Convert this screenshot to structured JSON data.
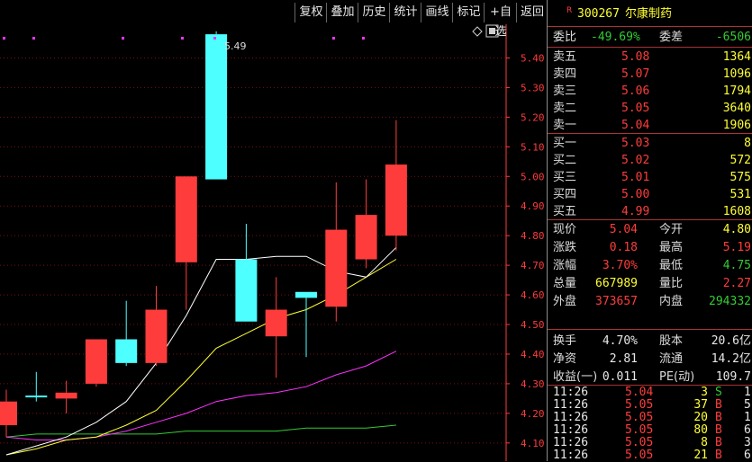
{
  "toolbar": {
    "buttons": [
      "复权",
      "叠加",
      "历史",
      "统计",
      "画线",
      "标记",
      "+自选",
      "返回"
    ]
  },
  "stock_header": {
    "badge": "R",
    "code": "300267",
    "name": "尔康制药"
  },
  "order_ratio": {
    "label": "委比",
    "value": "-49.69%",
    "diff_label": "委差",
    "diff_value": "-6506"
  },
  "asks": [
    {
      "label": "卖五",
      "price": "5.08",
      "volume": "1364"
    },
    {
      "label": "卖四",
      "price": "5.07",
      "volume": "1096"
    },
    {
      "label": "卖三",
      "price": "5.06",
      "volume": "1794"
    },
    {
      "label": "卖二",
      "price": "5.05",
      "volume": "3640"
    },
    {
      "label": "卖一",
      "price": "5.04",
      "volume": "1906"
    }
  ],
  "bids": [
    {
      "label": "买一",
      "price": "5.03",
      "volume": "8"
    },
    {
      "label": "买二",
      "price": "5.02",
      "volume": "572"
    },
    {
      "label": "买三",
      "price": "5.01",
      "volume": "575"
    },
    {
      "label": "买四",
      "price": "5.00",
      "volume": "531"
    },
    {
      "label": "买五",
      "price": "4.99",
      "volume": "1608"
    }
  ],
  "quote": [
    {
      "l1": "现价",
      "v1": "5.04",
      "c1": "red",
      "l2": "今开",
      "v2": "4.80",
      "c2": "yel"
    },
    {
      "l1": "涨跌",
      "v1": "0.18",
      "c1": "red",
      "l2": "最高",
      "v2": "5.19",
      "c2": "red"
    },
    {
      "l1": "涨幅",
      "v1": "3.70%",
      "c1": "red",
      "l2": "最低",
      "v2": "4.75",
      "c2": "grn"
    },
    {
      "l1": "总量",
      "v1": "667989",
      "c1": "yel",
      "l2": "量比",
      "v2": "2.27",
      "c2": "red"
    },
    {
      "l1": "外盘",
      "v1": "373657",
      "c1": "red",
      "l2": "内盘",
      "v2": "294332",
      "c2": "grn"
    }
  ],
  "fundamentals": [
    {
      "l1": "换手",
      "v1": "4.70%",
      "l2": "股本",
      "v2": "20.6亿"
    },
    {
      "l1": "净资",
      "v1": "2.81",
      "l2": "流通",
      "v2": "14.2亿"
    },
    {
      "l1": "收益(一)",
      "v1": "0.011",
      "l2": "PE(动)",
      "v2": "109.7"
    }
  ],
  "ticks": [
    {
      "time": "11:26",
      "price": "5.04",
      "vol": "3",
      "side": "S",
      "n": "1"
    },
    {
      "time": "11:26",
      "price": "5.05",
      "vol": "37",
      "side": "B",
      "n": "5"
    },
    {
      "time": "11:26",
      "price": "5.05",
      "vol": "20",
      "side": "B",
      "n": "1"
    },
    {
      "time": "11:26",
      "price": "5.05",
      "vol": "80",
      "side": "B",
      "n": "6"
    },
    {
      "time": "11:26",
      "price": "5.05",
      "vol": "8",
      "side": "B",
      "n": "3"
    },
    {
      "time": "11:26",
      "price": "5.05",
      "vol": "21",
      "side": "B",
      "n": "6"
    }
  ],
  "colors": {
    "up": "#ff3c3c",
    "down": "#4dffff",
    "ma5": "#ffffff",
    "ma10": "#ffff33",
    "ma20": "#ff33ff",
    "ma60": "#33cc33",
    "axis": "#ff3c3c",
    "grid": "#7a1010"
  },
  "chart_data": {
    "type": "candlestick",
    "y_ticks": [
      "5.40",
      "5.30",
      "5.20",
      "5.10",
      "5.00",
      "4.90",
      "4.80",
      "4.70",
      "4.60",
      "4.50",
      "4.40",
      "4.30",
      "4.20",
      "4.10"
    ],
    "ylim": [
      4.06,
      5.52
    ],
    "high_annotation": "5.49",
    "candles": [
      {
        "open": 4.16,
        "close": 4.24,
        "high": 4.28,
        "low": 4.12,
        "dir": "up"
      },
      {
        "open": 4.26,
        "close": 4.26,
        "high": 4.34,
        "low": 4.24,
        "dir": "down"
      },
      {
        "open": 4.25,
        "close": 4.27,
        "high": 4.31,
        "low": 4.2,
        "dir": "up"
      },
      {
        "open": 4.3,
        "close": 4.45,
        "high": 4.45,
        "low": 4.29,
        "dir": "up"
      },
      {
        "open": 4.45,
        "close": 4.37,
        "high": 4.58,
        "low": 4.36,
        "dir": "down"
      },
      {
        "open": 4.37,
        "close": 4.55,
        "high": 4.63,
        "low": 4.36,
        "dir": "up"
      },
      {
        "open": 4.71,
        "close": 5.0,
        "high": 5.0,
        "low": 4.55,
        "dir": "up"
      },
      {
        "open": 5.48,
        "close": 4.99,
        "high": 5.49,
        "low": 4.99,
        "dir": "down"
      },
      {
        "open": 4.72,
        "close": 4.51,
        "high": 4.84,
        "low": 4.51,
        "dir": "down"
      },
      {
        "open": 4.46,
        "close": 4.55,
        "high": 4.66,
        "low": 4.32,
        "dir": "up"
      },
      {
        "open": 4.61,
        "close": 4.59,
        "high": 4.61,
        "low": 4.39,
        "dir": "down"
      },
      {
        "open": 4.56,
        "close": 4.82,
        "high": 4.98,
        "low": 4.51,
        "dir": "up"
      },
      {
        "open": 4.72,
        "close": 4.87,
        "high": 4.99,
        "low": 4.69,
        "dir": "up"
      },
      {
        "open": 4.8,
        "close": 5.04,
        "high": 5.19,
        "low": 4.75,
        "dir": "up"
      }
    ],
    "ma5": [
      4.06,
      4.09,
      4.12,
      4.17,
      4.24,
      4.37,
      4.53,
      4.72,
      4.72,
      4.73,
      4.73,
      4.68,
      4.66,
      4.76
    ],
    "ma10": [
      4.06,
      4.08,
      4.11,
      4.12,
      4.16,
      4.21,
      4.31,
      4.42,
      4.47,
      4.52,
      4.55,
      4.6,
      4.66,
      4.72
    ],
    "ma20": [
      4.12,
      4.11,
      4.11,
      4.12,
      4.14,
      4.17,
      4.2,
      4.24,
      4.26,
      4.27,
      4.29,
      4.33,
      4.36,
      4.41
    ],
    "ma60": [
      4.12,
      4.13,
      4.13,
      4.13,
      4.13,
      4.13,
      4.14,
      4.14,
      4.14,
      4.14,
      4.15,
      4.15,
      4.15,
      4.16
    ]
  }
}
